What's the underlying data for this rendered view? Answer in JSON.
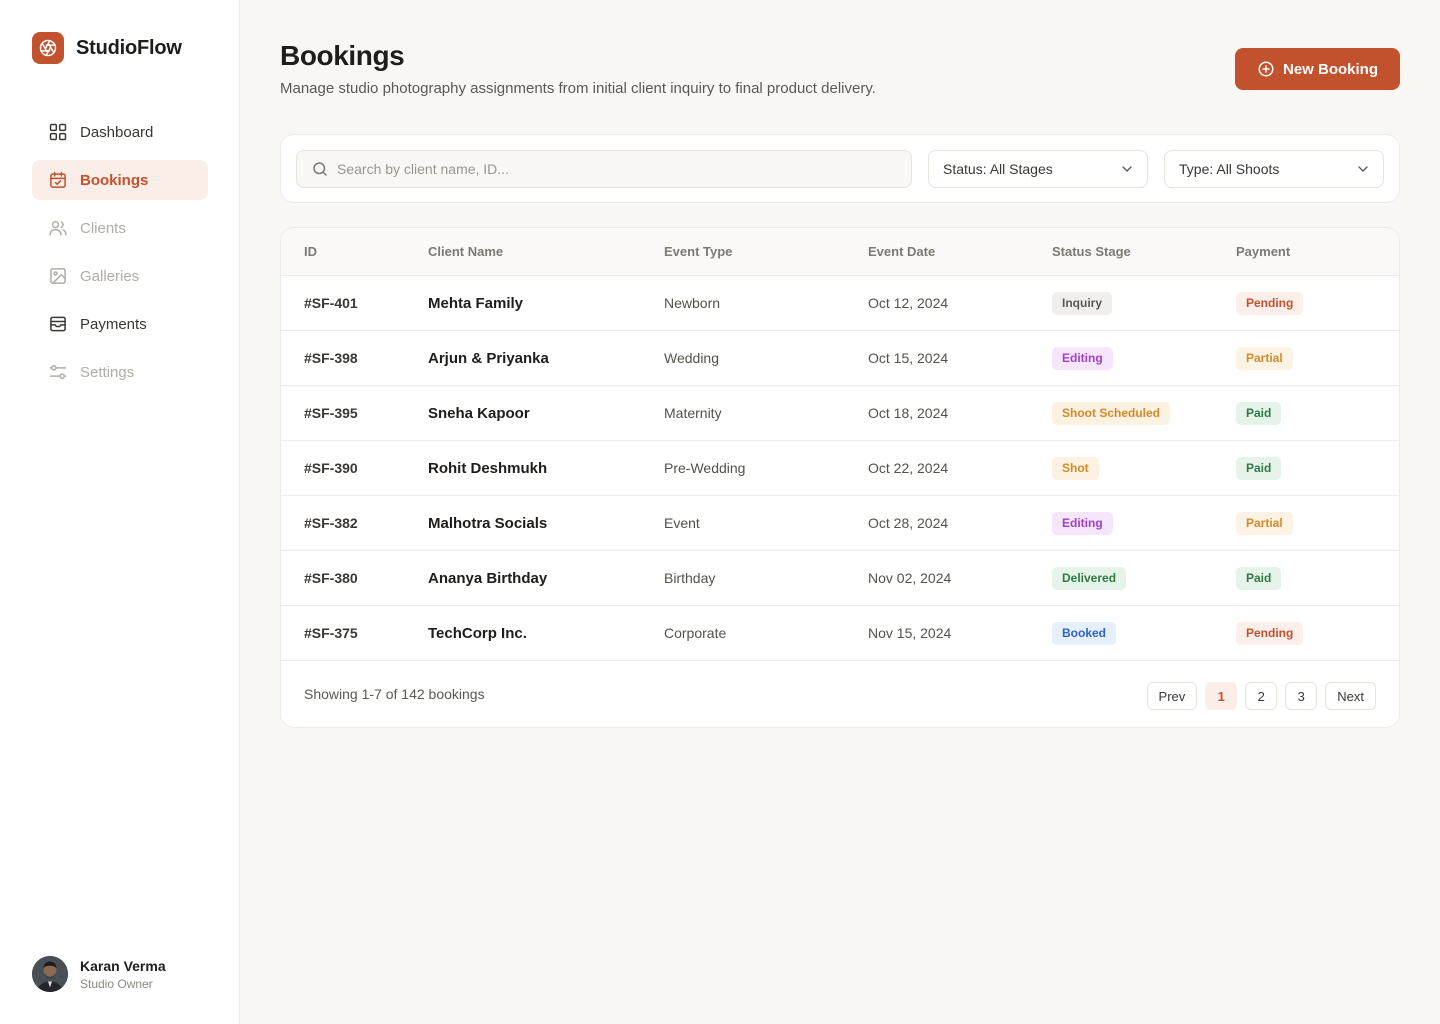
{
  "brand": {
    "name": "StudioFlow",
    "logo_icon": "aperture-icon",
    "color": "#c2522d"
  },
  "nav": [
    {
      "label": "Dashboard",
      "icon": "grid-icon",
      "state": "normal"
    },
    {
      "label": "Bookings",
      "icon": "calendar-check-icon",
      "state": "active"
    },
    {
      "label": "Clients",
      "icon": "users-icon",
      "state": "dim"
    },
    {
      "label": "Galleries",
      "icon": "image-icon",
      "state": "dim"
    },
    {
      "label": "Payments",
      "icon": "wallet-icon",
      "state": "normal"
    },
    {
      "label": "Settings",
      "icon": "sliders-icon",
      "state": "dim"
    }
  ],
  "user": {
    "name": "Karan Verma",
    "role": "Studio Owner"
  },
  "header": {
    "title": "Bookings",
    "subtitle": "Manage studio photography assignments from initial client inquiry to final product delivery.",
    "new_button": "New Booking"
  },
  "filters": {
    "search_placeholder": "Search by client name, ID...",
    "status": "Status: All Stages",
    "type": "Type: All Shoots"
  },
  "table": {
    "columns": [
      "ID",
      "Client Name",
      "Event Type",
      "Event Date",
      "Status Stage",
      "Payment"
    ],
    "rows": [
      {
        "id": "#SF-401",
        "client": "Mehta Family",
        "type": "Newborn",
        "date": "Oct 12, 2024",
        "status": "Inquiry",
        "payment": "Pending"
      },
      {
        "id": "#SF-398",
        "client": "Arjun & Priyanka",
        "type": "Wedding",
        "date": "Oct 15, 2024",
        "status": "Editing",
        "payment": "Partial"
      },
      {
        "id": "#SF-395",
        "client": "Sneha Kapoor",
        "type": "Maternity",
        "date": "Oct 18, 2024",
        "status": "Shoot Scheduled",
        "payment": "Paid"
      },
      {
        "id": "#SF-390",
        "client": "Rohit Deshmukh",
        "type": "Pre-Wedding",
        "date": "Oct 22, 2024",
        "status": "Shot",
        "payment": "Paid"
      },
      {
        "id": "#SF-382",
        "client": "Malhotra Socials",
        "type": "Event",
        "date": "Oct 28, 2024",
        "status": "Editing",
        "payment": "Partial"
      },
      {
        "id": "#SF-380",
        "client": "Ananya Birthday",
        "type": "Birthday",
        "date": "Nov 02, 2024",
        "status": "Delivered",
        "payment": "Paid"
      },
      {
        "id": "#SF-375",
        "client": "TechCorp Inc.",
        "type": "Corporate",
        "date": "Nov 15, 2024",
        "status": "Booked",
        "payment": "Pending"
      }
    ]
  },
  "badge_colors": {
    "Inquiry": {
      "bg": "#f0efed",
      "fg": "#5c5853"
    },
    "Editing": {
      "bg": "#f6e6fb",
      "fg": "#a33fc9"
    },
    "Shoot Scheduled": {
      "bg": "#fdf1e2",
      "fg": "#d58a2a"
    },
    "Shot": {
      "bg": "#fdf1e2",
      "fg": "#d58a2a"
    },
    "Delivered": {
      "bg": "#e6f3e9",
      "fg": "#2f7a45"
    },
    "Booked": {
      "bg": "#e6effc",
      "fg": "#2f62c9"
    },
    "Pending": {
      "bg": "#fcefeb",
      "fg": "#c2522d"
    },
    "Partial": {
      "bg": "#fdf3e4",
      "fg": "#d58a2a"
    },
    "Paid": {
      "bg": "#e6f3e9",
      "fg": "#2f7a45"
    }
  },
  "footer": {
    "showing": "Showing 1-7 of 142 bookings",
    "prev": "Prev",
    "pages": [
      "1",
      "2",
      "3"
    ],
    "active_page": "1",
    "next": "Next"
  }
}
